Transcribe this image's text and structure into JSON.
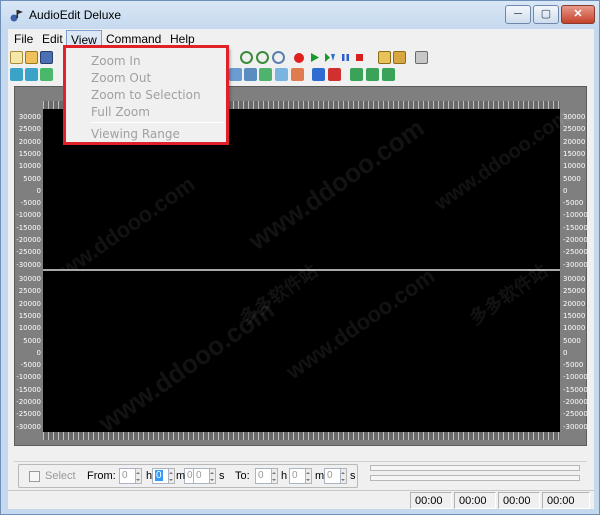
{
  "app": {
    "title": "AudioEdit Deluxe"
  },
  "window_buttons": {
    "minimize": "─",
    "maximize": "▢",
    "close": "✕"
  },
  "menu": [
    {
      "label": "File"
    },
    {
      "label": "Edit"
    },
    {
      "label": "View",
      "open": true
    },
    {
      "label": "Command"
    },
    {
      "label": "Help"
    }
  ],
  "view_menu": {
    "items": [
      "Zoom In",
      "Zoom Out",
      "Zoom to Selection",
      "Full Zoom",
      "Viewing Range"
    ]
  },
  "toolbar_icons_row1": [
    "new-file-icon",
    "open-folder-icon",
    "save-icon",
    "zoom-in-icon",
    "zoom-out-icon",
    "zoom-selection-icon",
    "record-icon",
    "play-icon",
    "play-loop-icon",
    "pause-icon",
    "stop-icon",
    "speaker-left-icon",
    "speaker-right-icon",
    "settings-icon"
  ],
  "toolbar_icons_row2": [
    "effect-1-icon",
    "effect-2-icon",
    "effect-3-icon",
    "effect-4-icon",
    "effect-5-icon",
    "effect-6-icon",
    "effect-7-icon",
    "effect-8-icon",
    "effect-9-icon",
    "effect-10-icon",
    "effect-11-icon",
    "effect-12-icon",
    "effect-13-icon"
  ],
  "amplitude_scale": [
    "30000",
    "25000",
    "20000",
    "15000",
    "10000",
    "5000",
    "0",
    "-5000",
    "-10000",
    "-15000",
    "-20000",
    "-25000",
    "-30000"
  ],
  "watermark": {
    "text": "www.ddooo.com",
    "cn": "多多软件站"
  },
  "selection": {
    "checkbox_label": "Select",
    "from_label": "From:",
    "to_label": "To:",
    "from": {
      "min": "0",
      "h": "0",
      "m": "0",
      "s": "0"
    },
    "to": {
      "min": "0",
      "h": "0",
      "m": "0",
      "s": "0"
    },
    "units": {
      "h": "h",
      "m": "m",
      "s": "s"
    }
  },
  "status": [
    "00:00",
    "00:00",
    "00:00",
    "00:00"
  ]
}
